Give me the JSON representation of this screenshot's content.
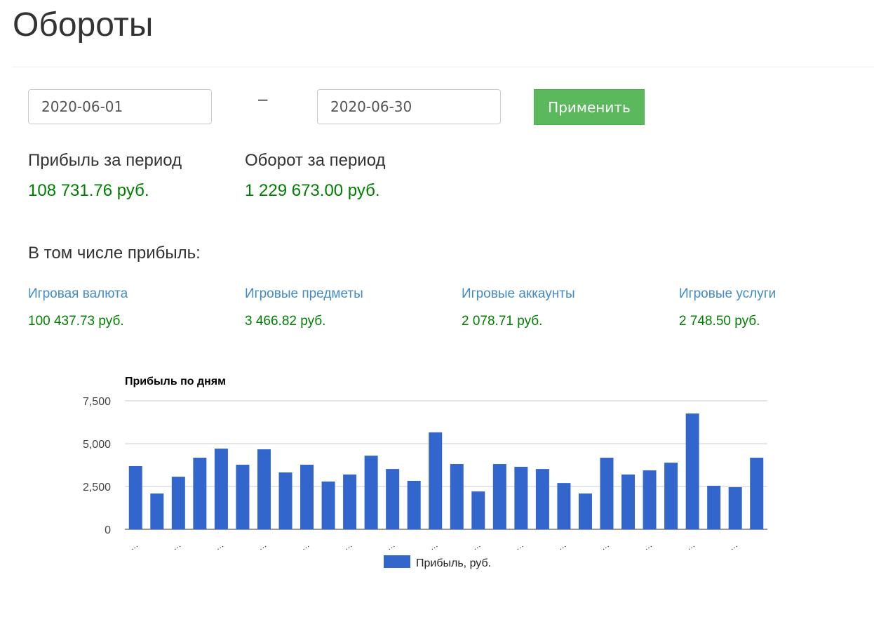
{
  "page_title": "Обороты",
  "filter": {
    "date_from": "2020-06-01",
    "separator": "–",
    "date_to": "2020-06-30",
    "apply_label": "Применить"
  },
  "summary": {
    "profit_label": "Прибыль за период",
    "profit_value": "108 731.76 руб.",
    "turnover_label": "Оборот за период",
    "turnover_value": "1 229 673.00 руб."
  },
  "breakdown": {
    "heading": "В том числе прибыль:",
    "items": [
      {
        "label": "Игровая валюта",
        "value": "100 437.73 руб."
      },
      {
        "label": "Игровые предметы",
        "value": "3 466.82 руб."
      },
      {
        "label": "Игровые аккаунты",
        "value": "2 078.71 руб."
      },
      {
        "label": "Игровые услуги",
        "value": "2 748.50 руб."
      }
    ]
  },
  "colors": {
    "bar": "#3366cc",
    "profit": "#008000",
    "link": "#428bca",
    "apply": "#5cb85c"
  },
  "chart_data": {
    "type": "bar",
    "title": "Прибыль по дням",
    "categories": [
      "…",
      "…",
      "…",
      "…",
      "…",
      "…",
      "…",
      "…",
      "…",
      "…",
      "…",
      "…",
      "…",
      "…",
      "…",
      "…",
      "…",
      "…",
      "…",
      "…",
      "…",
      "…",
      "…",
      "…",
      "…",
      "…",
      "…",
      "…",
      "…",
      "…"
    ],
    "series": [
      {
        "name": "Прибыль, руб.",
        "values": [
          3690,
          2090,
          3070,
          4180,
          4710,
          3770,
          4670,
          3320,
          3770,
          2790,
          3200,
          4300,
          3520,
          2830,
          5660,
          3810,
          2210,
          3810,
          3650,
          3520,
          2700,
          2090,
          4180,
          3200,
          3440,
          3890,
          6760,
          2540,
          2460,
          4180
        ]
      }
    ],
    "ylim": [
      0,
      7500
    ],
    "yticks": [
      "0",
      "2,500",
      "5,000",
      "7,500"
    ],
    "grid": true,
    "legend": "bottom"
  }
}
